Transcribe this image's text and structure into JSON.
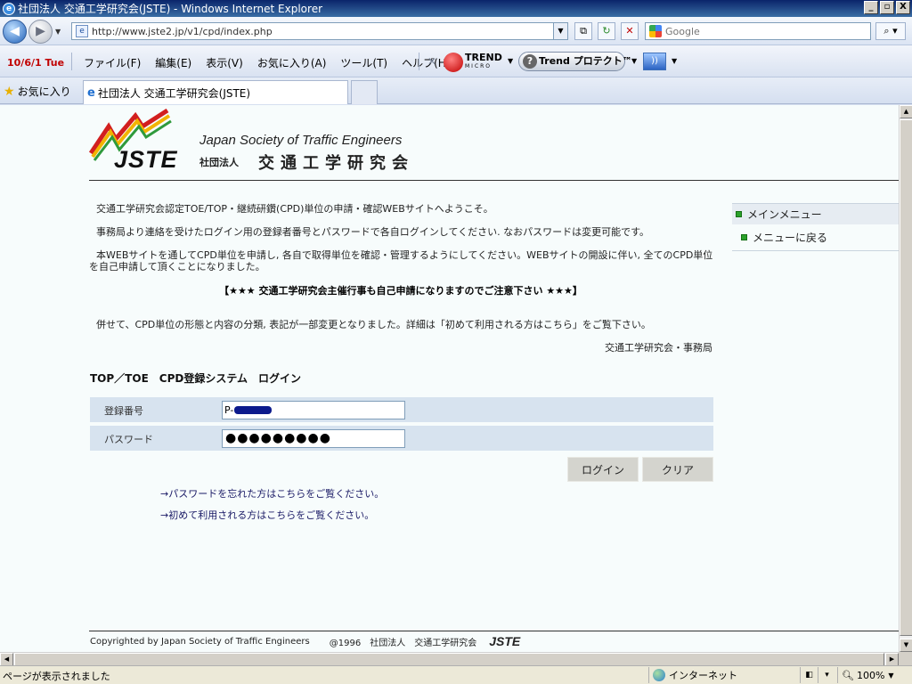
{
  "window": {
    "title": "社団法人 交通工学研究会(JSTE) - Windows Internet Explorer",
    "min": "_",
    "max": "▫",
    "close": "X"
  },
  "addressbar": {
    "url": "http://www.jste2.jp/v1/cpd/index.php",
    "search_placeholder": "Google"
  },
  "clock_badge": "10/6/1 Tue",
  "menu": {
    "items": [
      "ファイル(F)",
      "編集(E)",
      "表示(V)",
      "お気に入り(A)",
      "ツール(T)",
      "ヘルプ(H)"
    ]
  },
  "trend": {
    "logo_text": "TREND",
    "logo_sub": "MICRO",
    "protect_label": "Trend プロテクト™"
  },
  "favorites_label": "お気に入り",
  "tab": {
    "title": "社団法人 交通工学研究会(JSTE)"
  },
  "logo": {
    "mark": "JSTE",
    "english": "Japan Society of Traffic Engineers",
    "ja_small": "社団法人",
    "ja_big": "交通工学研究会"
  },
  "intro": {
    "p1": "交通工学研究会認定TOE/TOP・継続研鑽(CPD)単位の申請・確認WEBサイトへようこそ。",
    "p2": "事務局より連絡を受けたログイン用の登録者番号とパスワードで各自ログインしてください. なおパスワードは変更可能です。",
    "p3a": "本WEBサイトを通してCPD単位を申請し, 各自で取得単位を確認・管理するようにしてください。WEBサイトの開設に伴い, 全てのCPD単位",
    "p3b": "を自己申請して頂くことになりました。",
    "notice": "【★★★ 交通工学研究会主催行事も自己申請になりますのでご注意下さい ★★★】",
    "p4": "併せて、CPD単位の形態と内容の分類, 表記が一部変更となりました。詳細は「初めて利用される方はこちら」をご覧下さい。",
    "signoff": "交通工学研究会・事務局"
  },
  "login": {
    "title": "TOP／TOE　CPD登録システム　ログイン",
    "id_label": "登録番号",
    "id_value": "P-",
    "pw_label": "パスワード",
    "pw_mask": "●●●●●●●●●",
    "login_button": "ログイン",
    "clear_button": "クリア",
    "forgot_link": "→パスワードを忘れた方はこちらをご覧ください。",
    "first_link": "→初めて利用される方はこちらをご覧ください。"
  },
  "sidemenu": {
    "header": "メインメニュー",
    "back": "メニューに戻る"
  },
  "footer": {
    "copyright": "Copyrighted by Japan Society of Traffic Engineers",
    "year": "@1996　社団法人　交通工学研究会",
    "logo": "JSTE"
  },
  "status": {
    "message": "ページが表示されました",
    "zone": "インターネット",
    "zoom": "100%"
  }
}
